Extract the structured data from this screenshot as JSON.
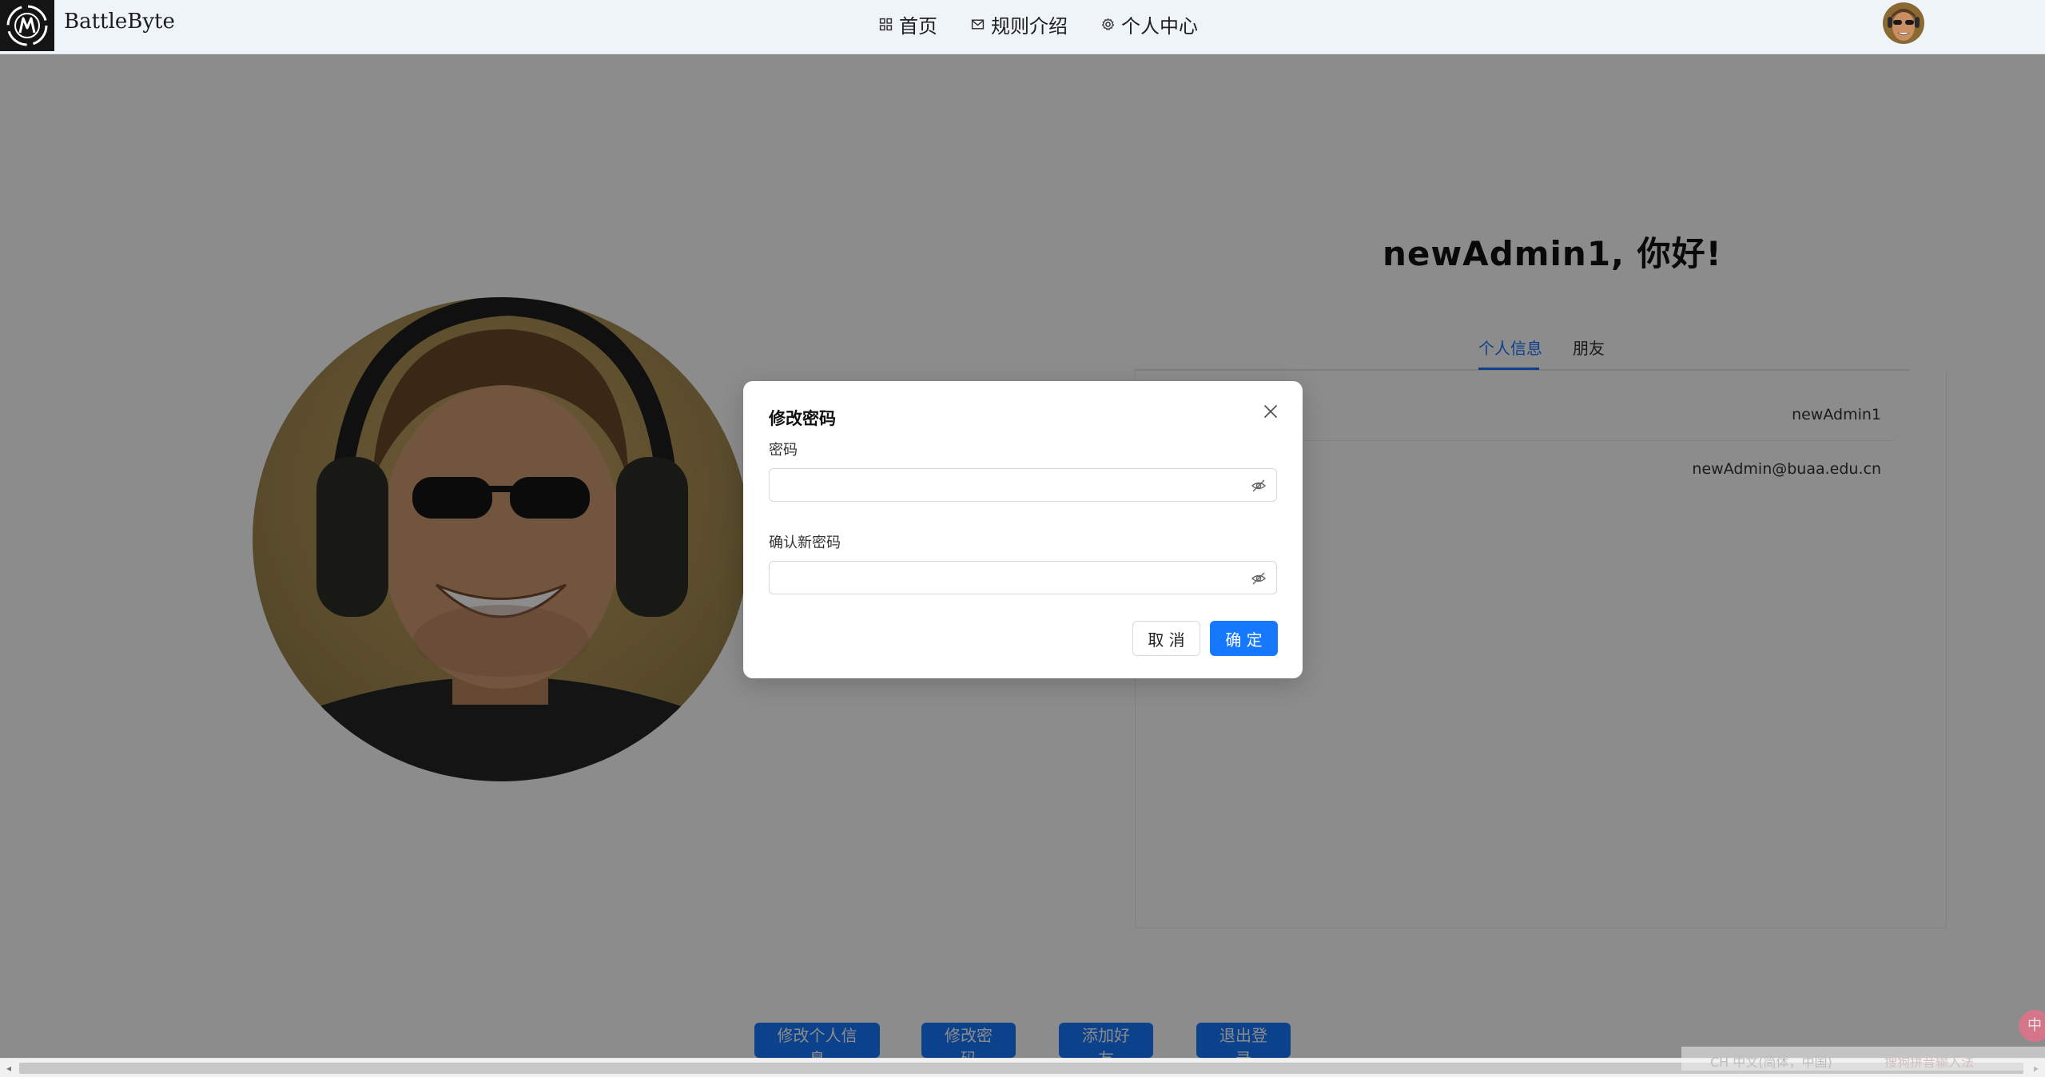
{
  "header": {
    "brand": "BattleByte",
    "nav": [
      {
        "label": "首页",
        "icon": "grid-icon"
      },
      {
        "label": "规则介绍",
        "icon": "mail-icon"
      },
      {
        "label": "个人中心",
        "icon": "gear-icon"
      }
    ]
  },
  "profile": {
    "greeting": "newAdmin1, 你好!",
    "tabs": [
      {
        "label": "个人信息",
        "active": true
      },
      {
        "label": "朋友",
        "active": false
      }
    ],
    "username": "newAdmin1",
    "email": "newAdmin@buaa.edu.cn"
  },
  "actions": {
    "edit_info": "修改个人信息",
    "change_password": "修改密码",
    "add_friend": "添加好友",
    "logout": "退出登录"
  },
  "dialog": {
    "title": "修改密码",
    "password_label": "密码",
    "password_value": "",
    "confirm_label": "确认新密码",
    "confirm_value": "",
    "cancel_label": "取 消",
    "ok_label": "确 定"
  },
  "ime": {
    "language": "CH 中文(简体，中国)",
    "input_method": "搜狗拼音输入法",
    "badge": "中"
  },
  "colors": {
    "primary": "#1677ff",
    "navbar_bg": "#eef4f8",
    "mask": "rgba(0,0,0,0.45)"
  }
}
